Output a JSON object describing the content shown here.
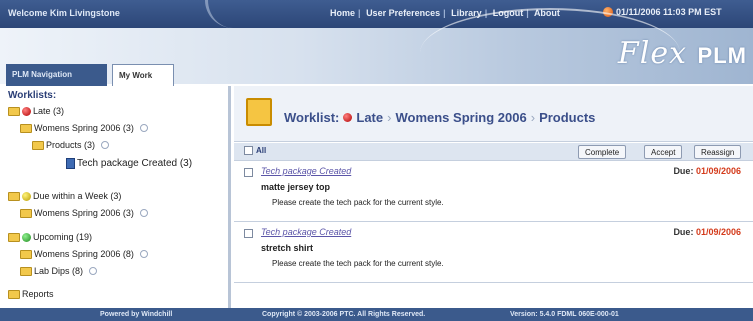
{
  "topbar": {
    "welcome": "Welcome Kim Livingstone",
    "nav": [
      "Home",
      "User Preferences",
      "Library",
      "Logout",
      "About"
    ],
    "clock": "01/11/2006 11:03 PM EST"
  },
  "banner": {
    "logo_main": "Flex",
    "logo_bold": "PLM"
  },
  "tabs": {
    "nav": "PLM Navigation",
    "work": "My Work"
  },
  "tree": {
    "title": "Worklists:",
    "late": "Late (3)",
    "late_season": "Womens Spring 2006 (3)",
    "late_products": "Products (3)",
    "late_task": "Tech package Created (3)",
    "due": "Due within a Week (3)",
    "due_season": "Womens Spring 2006 (3)",
    "upcoming": "Upcoming (19)",
    "up_season": "Womens Spring 2006 (8)",
    "up_lab": "Lab Dips (8)",
    "reports": "Reports"
  },
  "main": {
    "crumb_prefix": "Worklist:",
    "crumb_late": "Late",
    "crumb_season": "Womens Spring 2006",
    "crumb_products": "Products",
    "all_label": "All",
    "btn_complete": "Complete",
    "btn_accept": "Accept",
    "btn_reassign": "Reassign",
    "items": [
      {
        "link": "Tech package Created",
        "due_label": "Due:",
        "due_date": "01/09/2006",
        "name": "matte jersey top",
        "msg": "Please create the tech pack for the current style."
      },
      {
        "link": "Tech package Created",
        "due_label": "Due:",
        "due_date": "01/09/2006",
        "name": "stretch shirt",
        "msg": "Please create the tech pack for the current style."
      }
    ]
  },
  "footer": {
    "powered": "Powered by Windchill",
    "copyright": "Copyright © 2003-2006 PTC. All Rights Reserved.",
    "version": "Version: 5.4.0 FDML 060E-000-01"
  },
  "colors": {
    "nav_blue": "#3b5a8c",
    "due_red": "#d43a1a",
    "link_purple": "#5b55a8"
  }
}
